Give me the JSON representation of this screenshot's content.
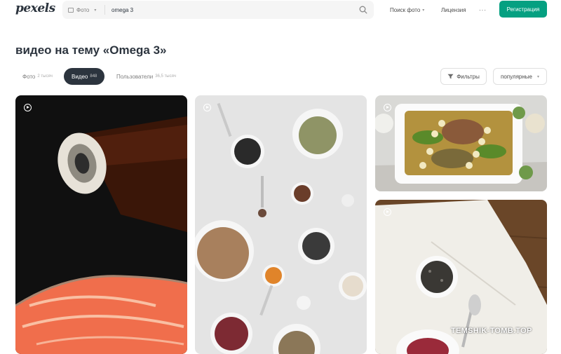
{
  "header": {
    "logo": "pexels",
    "search": {
      "type_label": "Фото",
      "query": "omega 3"
    },
    "nav": {
      "photo_search": "Поиск фото",
      "license": "Лицензия",
      "more": "···"
    },
    "register_label": "Регистрация"
  },
  "page_title": "видео на тему «Omega 3»",
  "tabs": [
    {
      "label": "Фото",
      "count": "2 тысяч"
    },
    {
      "label": "Видео",
      "count": "848"
    },
    {
      "label": "Пользователи",
      "count": "36,5 тысяч"
    }
  ],
  "filters_label": "Фильтры",
  "sort_label": "популярные",
  "watermark": "TEMSHIK-TOMB.TOP",
  "colors": {
    "accent": "#05a081",
    "dark": "#2c343e"
  }
}
